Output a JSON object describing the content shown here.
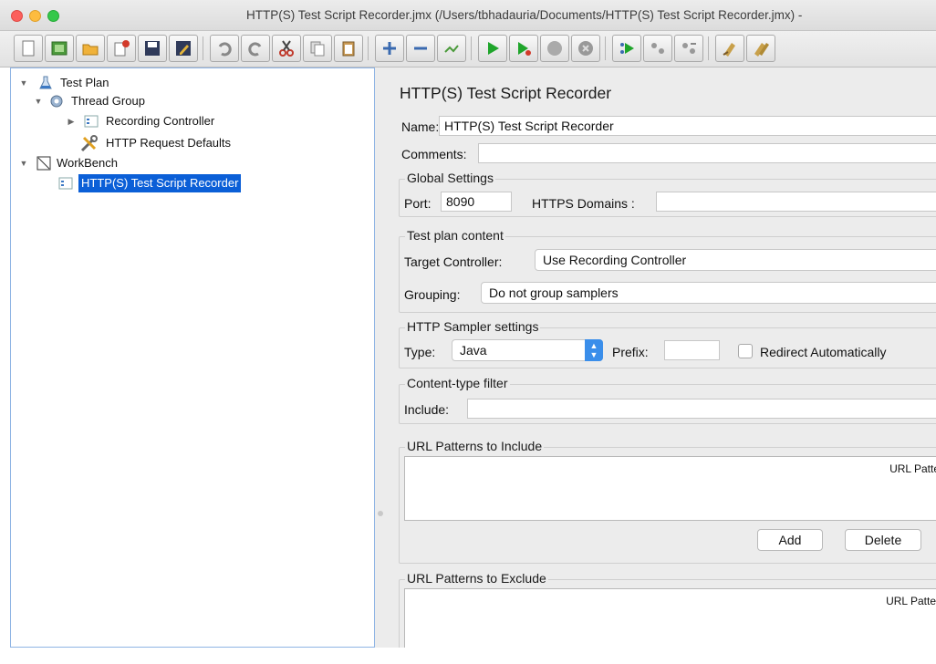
{
  "window": {
    "title": "HTTP(S) Test Script Recorder.jmx (/Users/tbhadauria/Documents/HTTP(S) Test Script Recorder.jmx) -"
  },
  "toolbar": {
    "buttons": [
      "new-icon",
      "templates-icon",
      "open-icon",
      "close-icon",
      "save-icon",
      "save-as-icon",
      "undo-icon",
      "redo-icon",
      "cut-icon",
      "copy-icon",
      "paste-icon",
      "expand-icon",
      "collapse-icon",
      "toggle-icon",
      "start-icon",
      "start-no-pause-icon",
      "stop-icon",
      "shutdown-icon",
      "remote-start-icon",
      "remote-stop-icon",
      "remote-shutdown-icon",
      "clear-icon",
      "clear-all-icon"
    ]
  },
  "tree": {
    "items": [
      {
        "label": "Test Plan",
        "icon": "flask-icon"
      },
      {
        "label": "Thread Group",
        "icon": "gear-icon"
      },
      {
        "label": "Recording Controller",
        "icon": "controller-icon"
      },
      {
        "label": "HTTP Request Defaults",
        "icon": "tools-icon"
      },
      {
        "label": "WorkBench",
        "icon": "workbench-icon"
      },
      {
        "label": "HTTP(S) Test Script Recorder",
        "icon": "recorder-icon"
      }
    ]
  },
  "main": {
    "title": "HTTP(S) Test Script Recorder",
    "name_label": "Name:",
    "name_value": "HTTP(S) Test Script Recorder",
    "comments_label": "Comments:",
    "global": {
      "legend": "Global Settings",
      "port_label": "Port:",
      "port_value": "8090",
      "https_label": "HTTPS Domains :"
    },
    "plan": {
      "legend": "Test plan content",
      "target_label": "Target Controller:",
      "target_value": "Use Recording Controller",
      "grouping_label": "Grouping:",
      "grouping_value": "Do not group samplers"
    },
    "sampler": {
      "legend": "HTTP Sampler settings",
      "type_label": "Type:",
      "type_value": "Java",
      "prefix_label": "Prefix:",
      "redirect_label": "Redirect Automatically"
    },
    "content_filter": {
      "legend": "Content-type filter",
      "include_label": "Include:"
    },
    "include_patterns": {
      "legend": "URL Patterns to Include",
      "column": "URL Patter",
      "add_label": "Add",
      "delete_label": "Delete"
    },
    "exclude_patterns": {
      "legend": "URL Patterns to Exclude",
      "column": "URL Patterr"
    }
  }
}
